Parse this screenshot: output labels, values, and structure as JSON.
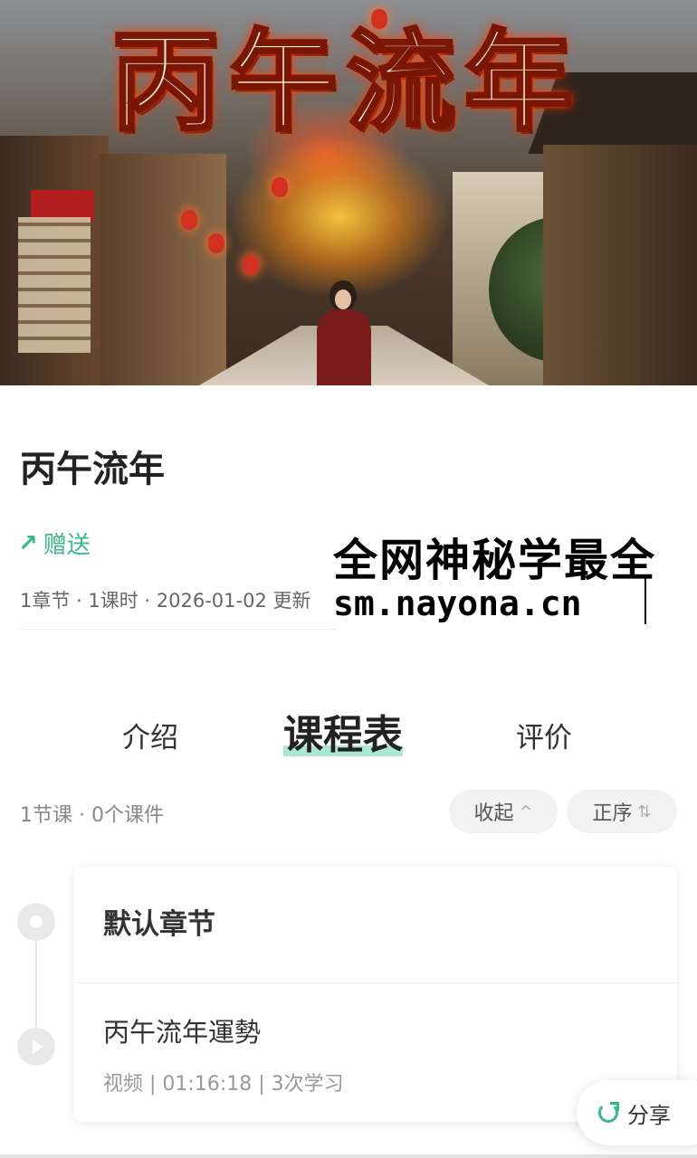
{
  "banner": {
    "title_chars": [
      "丙",
      "午",
      "流",
      "年"
    ]
  },
  "course": {
    "title": "丙午流年",
    "gift_label": "赠送",
    "meta": "1章节 · 1课时 · 2026-01-02 更新"
  },
  "watermark": {
    "line1": "全网神秘学最全",
    "line2": "sm.nayona.cn"
  },
  "tabs": {
    "intro": "介绍",
    "schedule": "课程表",
    "reviews": "评价"
  },
  "summary": {
    "text": "1节课 · 0个课件",
    "collapse_label": "收起",
    "collapse_icon": "^",
    "order_label": "正序",
    "order_icon": "⇅"
  },
  "chapter": {
    "name": "默认章节",
    "lesson_title": "丙午流年運勢",
    "lesson_meta": "视频 | 01:16:18 | 3次学习"
  },
  "share": {
    "label": "分享"
  },
  "colors": {
    "accent": "#39b886",
    "tab_highlight": "#6bd3a8"
  }
}
